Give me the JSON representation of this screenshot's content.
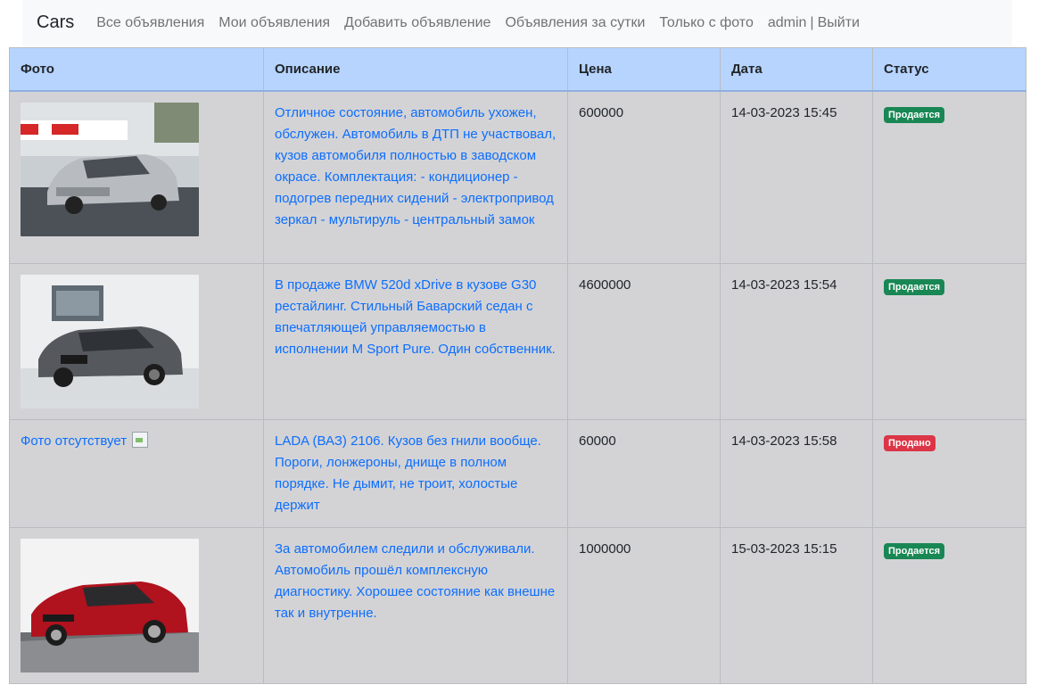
{
  "navbar": {
    "brand": "Cars",
    "links": [
      "Все объявления",
      "Мои объявления",
      "Добавить объявление",
      "Объявления за сутки",
      "Только с фото"
    ],
    "user": "admin",
    "separator": "|",
    "logout": "Выйти"
  },
  "table": {
    "headers": {
      "photo": "Фото",
      "description": "Описание",
      "price": "Цена",
      "date": "Дата",
      "status": "Статус"
    },
    "rows": [
      {
        "photo_icon": "car-photo-silver-hatchback",
        "description": "Отличное состояние, автомобиль ухожен, обслужен. Автомобиль в ДТП не участвовал, кузов автомобиля полностью в заводском окрасе. Комплектация: - кондиционер - подогрев передних сидений - электропривод зеркал - мультируль - центральный замок",
        "price": "600000",
        "date": "14-03-2023 15:45",
        "status": "Продается"
      },
      {
        "photo_icon": "car-photo-grey-sedan",
        "description": "В продаже BMW 520d xDrive в кузове G30 рестайлинг. Стильный Баварский седан с впечатляющей управляемостью в исполнении M Sport Pure. Один собственник.",
        "price": "4600000",
        "date": "14-03-2023 15:54",
        "status": "Продается"
      },
      {
        "no_photo": "Фото отсутствует",
        "description": "LADA (ВАЗ) 2106. Кузов без гнили вообще. Пороги, лонжероны, днище в полном порядке. Не дымит, не троит, холостые держит",
        "price": "60000",
        "date": "14-03-2023 15:58",
        "status": "Продано"
      },
      {
        "photo_icon": "car-photo-red-sedan",
        "description": "За автомобилем следили и обслуживали. Автомобиль прошёл комплексную диагностику. Хорошее состояние как внешне так и внутренне.",
        "price": "1000000",
        "date": "15-03-2023 15:15",
        "status": "Продается"
      }
    ]
  },
  "colors": {
    "header_bg": "#b6d4fe",
    "row_bg": "#d3d3d6",
    "link": "#0d6efd",
    "status_sale": "#198754",
    "status_sold": "#dc3545"
  }
}
